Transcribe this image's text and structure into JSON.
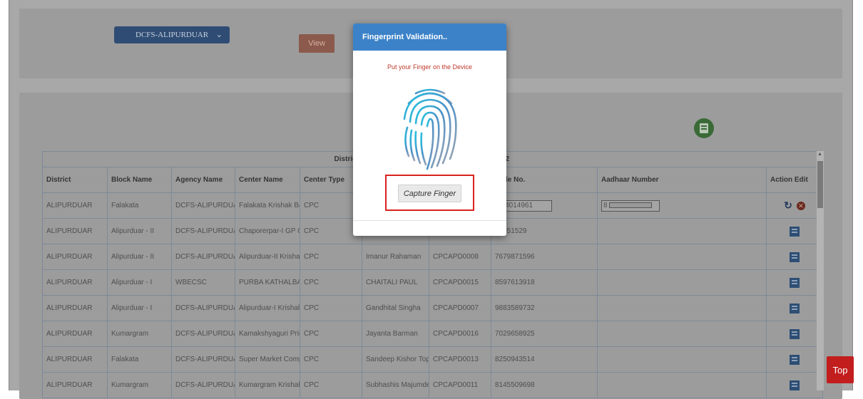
{
  "filter": {
    "agency_select": "DCFS-ALIPURDUAR",
    "view_label": "View"
  },
  "table": {
    "caption_left": "District",
    "caption_right": "2:52",
    "columns": [
      "District",
      "Block Name",
      "Agency Name",
      "Center Name",
      "Center Type",
      "",
      "",
      "obile No.",
      "Aadhaar Number",
      "Action Edit"
    ],
    "rows": [
      [
        "ALIPURDUAR",
        "Falakata",
        "DCFS-ALIPURDUAF",
        "Falakata Krishak Ba:",
        "CPC",
        "",
        "",
        "944014961",
        "8",
        ""
      ],
      [
        "ALIPURDUAR",
        "Alipurduar - II",
        "DCFS-ALIPURDUAF",
        "Chaporerpar-I GP Of",
        "CPC",
        "",
        "",
        "02051529",
        "",
        ""
      ],
      [
        "ALIPURDUAR",
        "Alipurduar - II",
        "DCFS-ALIPURDUAF",
        "Alipurduar-II Krishak",
        "CPC",
        "Imanur Rahaman",
        "CPCAPD0008",
        "7679871596",
        "",
        ""
      ],
      [
        "ALIPURDUAR",
        "Alipurduar - I",
        "WBECSC",
        "PURBA KATHALBAF",
        "CPC",
        "CHAITALI PAUL",
        "CPCAPD0015",
        "8597613918",
        "",
        ""
      ],
      [
        "ALIPURDUAR",
        "Alipurduar - I",
        "DCFS-ALIPURDUAF",
        "Alipurduar-I Krishak I",
        "CPC",
        "Gandhital Singha",
        "CPCAPD0007",
        "9883589732",
        "",
        ""
      ],
      [
        "ALIPURDUAR",
        "Kumargram",
        "DCFS-ALIPURDUAF",
        "Kamakshyaguri Prin",
        "CPC",
        "Jayanta Barman",
        "CPCAPD0016",
        "7029658925",
        "",
        ""
      ],
      [
        "ALIPURDUAR",
        "Falakata",
        "DCFS-ALIPURDUAF",
        "Super Market Compl",
        "CPC",
        "Sandeep Kishor Top",
        "CPCAPD0013",
        "8250943514",
        "",
        ""
      ],
      [
        "ALIPURDUAR",
        "Kumargram",
        "DCFS-ALIPURDUAF",
        "Kumargram Krishak",
        "CPC",
        "Subhashis Majumde",
        "CPCAPD0011",
        "8145509698",
        "",
        ""
      ]
    ]
  },
  "modal": {
    "title": "Fingerprint Validation..",
    "message": "Put your Finger on the Device",
    "capture_label": "Capture Finger"
  },
  "top_button": "Top",
  "icons": {
    "dropdown": "chevron-down-icon",
    "export": "export-icon",
    "refresh": "refresh-icon",
    "delete": "delete-icon",
    "edit": "edit-icon",
    "fingerprint": "fingerprint-icon"
  },
  "colors": {
    "modal_header": "#3c82c8",
    "message": "#c0392b",
    "highlight": "#d9231e",
    "top_button": "#c21e1e"
  }
}
